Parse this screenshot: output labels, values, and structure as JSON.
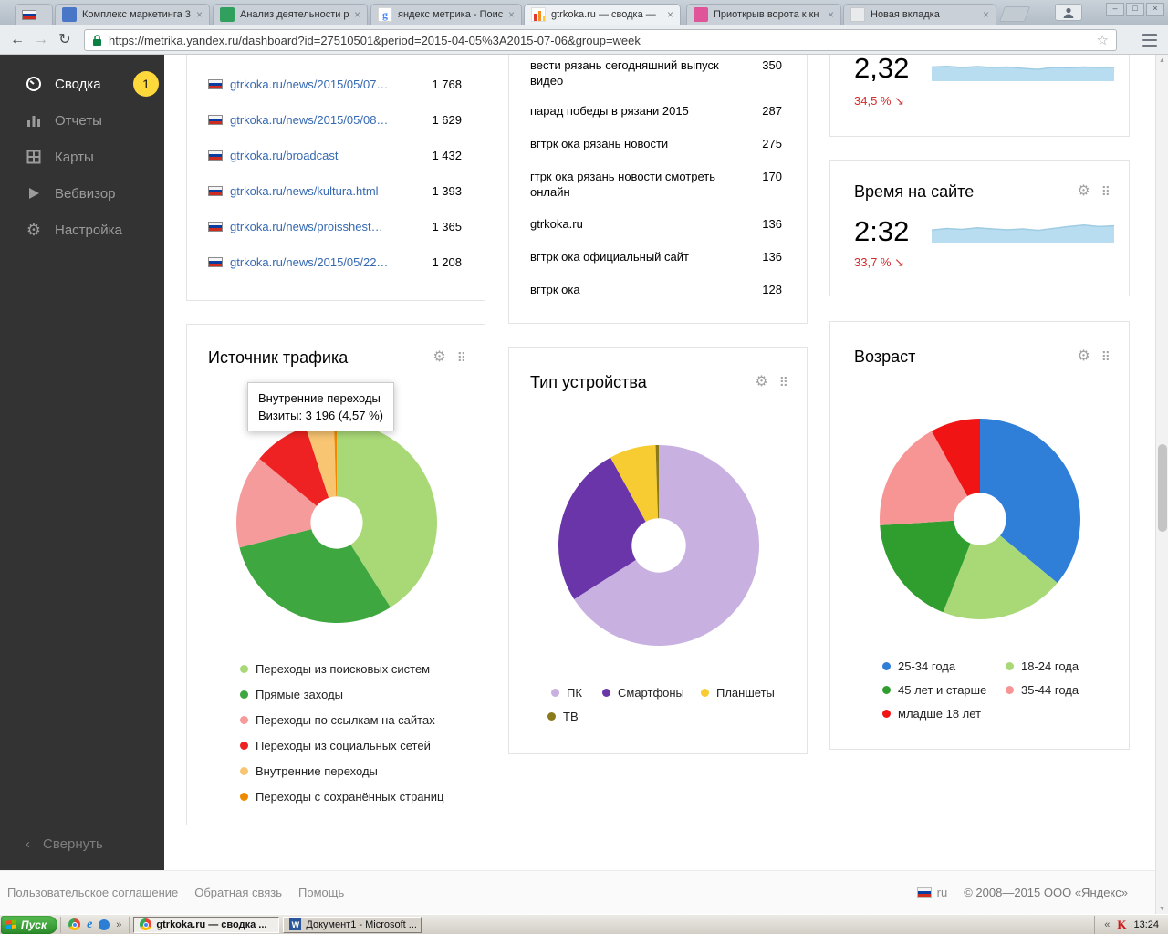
{
  "colors": {
    "accent_link": "#3569b2",
    "negative_red": "#d42a2a",
    "badge_yellow": "#ffd93b",
    "sidebar_bg": "#333333",
    "sparkline_fill": "#b8ddf0"
  },
  "browser": {
    "tabs": [
      {
        "title": "Комплекс маркетинга 3"
      },
      {
        "title": "Анализ деятельности р"
      },
      {
        "title": "яндекс метрика - Поиск"
      },
      {
        "title": "gtrkoka.ru — сводка —",
        "active": true
      },
      {
        "title": "Приоткрыв ворота к кн"
      },
      {
        "title": "Новая вкладка"
      }
    ],
    "url": "https://metrika.yandex.ru/dashboard?id=27510501&period=2015-04-05%3A2015-07-06&group=week"
  },
  "sidebar": {
    "items": [
      {
        "label": "Сводка",
        "badge": "1",
        "active": true
      },
      {
        "label": "Отчеты"
      },
      {
        "label": "Карты"
      },
      {
        "label": "Вебвизор"
      },
      {
        "label": "Настройка"
      }
    ],
    "collapse": "Свернуть"
  },
  "popular_pages": {
    "rows": [
      {
        "url": "gtrkoka.ru/news/2015/05/07…",
        "count": "1 768"
      },
      {
        "url": "gtrkoka.ru/news/2015/05/08…",
        "count": "1 629"
      },
      {
        "url": "gtrkoka.ru/broadcast",
        "count": "1 432"
      },
      {
        "url": "gtrkoka.ru/news/kultura.html",
        "count": "1 393"
      },
      {
        "url": "gtrkoka.ru/news/proisshest…",
        "count": "1 365"
      },
      {
        "url": "gtrkoka.ru/news/2015/05/22…",
        "count": "1 208"
      }
    ]
  },
  "search_phrases": {
    "rows": [
      {
        "phrase": "вести рязань сегодняшний выпуск видео",
        "count": "350"
      },
      {
        "phrase": "парад победы в рязани 2015",
        "count": "287"
      },
      {
        "phrase": "вгтрк ока рязань новости",
        "count": "275"
      },
      {
        "phrase": "гтрк ока рязань новости смотреть онлайн",
        "count": "170"
      },
      {
        "phrase": "gtrkoka.ru",
        "count": "136"
      },
      {
        "phrase": "вгтрк ока официальный сайт",
        "count": "136"
      },
      {
        "phrase": "вгтрк ока",
        "count": "128"
      }
    ]
  },
  "depth_widget": {
    "value": "2,32",
    "change": "34,5 %",
    "arrow": "↘"
  },
  "time_widget": {
    "title": "Время на сайте",
    "value": "2:32",
    "change": "33,7 %",
    "arrow": "↘"
  },
  "traffic_widget": {
    "title": "Источник трафика",
    "tooltip_title": "Внутренние переходы",
    "tooltip_value": "Визиты: 3 196 (4,57 %)"
  },
  "device_widget": {
    "title": "Тип устройства"
  },
  "age_widget": {
    "title": "Возраст"
  },
  "chart_data": [
    {
      "id": "traffic_sources_pie",
      "type": "pie",
      "title": "Источник трафика",
      "labels": [
        "Переходы из поисковых систем",
        "Прямые заходы",
        "Переходы по ссылкам на сайтах",
        "Переходы из социальных сетей",
        "Внутренние переходы",
        "Переходы с сохранённых страниц"
      ],
      "values": [
        41,
        30,
        15,
        9,
        4.57,
        0.43
      ],
      "unit": "percent of visits",
      "colors": [
        "#a9d977",
        "#3fa73f",
        "#f59b9b",
        "#ee2222",
        "#f8c572",
        "#ef8a00"
      ],
      "donut_hole": 0.26,
      "legend_position": "bottom",
      "annotation": {
        "label": "Внутренние переходы",
        "value": "Визиты: 3 196 (4,57 %)"
      }
    },
    {
      "id": "device_type_pie",
      "type": "pie",
      "title": "Тип устройства",
      "labels": [
        "ПК",
        "Смартфоны",
        "Планшеты",
        "ТВ"
      ],
      "values": [
        66,
        26,
        7.5,
        0.5
      ],
      "unit": "percent of visits",
      "colors": [
        "#c8b1e0",
        "#6a35a8",
        "#f7cc33",
        "#8a7a1a"
      ],
      "donut_hole": 0.27,
      "legend_position": "bottom"
    },
    {
      "id": "age_pie",
      "type": "pie",
      "title": "Возраст",
      "labels": [
        "25-34 года",
        "18-24 года",
        "45 лет и старше",
        "35-44 года",
        "младше 18 лет"
      ],
      "values": [
        36,
        20,
        18,
        18,
        8
      ],
      "unit": "percent of visits",
      "colors": [
        "#2f7ed8",
        "#a9d977",
        "#2f9e2f",
        "#f79595",
        "#f01414"
      ],
      "donut_hole": 0.26,
      "legend_position": "bottom"
    },
    {
      "id": "depth_spark",
      "type": "area",
      "title": "",
      "values": [
        0.52,
        0.55,
        0.5,
        0.54,
        0.5,
        0.52,
        0.46,
        0.42,
        0.5,
        0.48,
        0.52,
        0.5,
        0.51
      ],
      "color": "#b8ddf0",
      "line_color": "#9fcbe3",
      "note": "sparkline, relative heights"
    },
    {
      "id": "time_spark",
      "type": "area",
      "title": "Время на сайте",
      "values": [
        0.45,
        0.52,
        0.48,
        0.55,
        0.5,
        0.46,
        0.5,
        0.44,
        0.52,
        0.6,
        0.66,
        0.6,
        0.63
      ],
      "color": "#b8ddf0",
      "line_color": "#9fcbe3",
      "note": "sparkline, relative heights"
    }
  ],
  "footer": {
    "links": [
      "Пользовательское соглашение",
      "Обратная связь",
      "Помощь"
    ],
    "lang": "ru",
    "copyright": "© 2008—2015  ООО «Яндекс»"
  },
  "taskbar": {
    "start": "Пуск",
    "tasks": [
      "gtrkoka.ru — сводка ...",
      "Документ1 - Microsoft ..."
    ],
    "time": "13:24"
  }
}
